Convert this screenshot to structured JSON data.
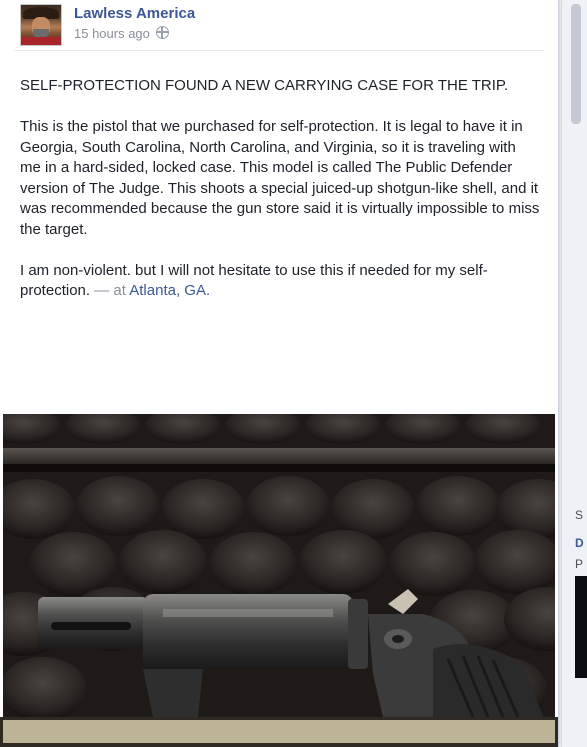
{
  "post": {
    "author": "Lawless America",
    "timestamp": "15 hours ago",
    "paragraphs": [
      "SELF-PROTECTION FOUND A NEW CARRYING CASE FOR THE TRIP.",
      "This is the pistol that we purchased for self-protection. It is legal to have it in Georgia, South Carolina, North Carolina, and Virginia, so it is traveling with me in a hard-sided, locked case. This model is called The Public Defender version of The Judge. This shoots a special juiced-up shotgun-like shell, and it was recommended because the gun store said it is virtually impossible to miss the target."
    ],
    "closing": "I am non-violent. but I will not hesitate to use this if needed for my self-protection.",
    "location_prefix": "— at",
    "location": "Atlanta, GA."
  },
  "side": {
    "frag1": "S",
    "frag2": "D",
    "frag3": "P"
  },
  "icons": {
    "privacy": "globe-icon"
  },
  "colors": {
    "link": "#3b5998",
    "meta": "#898f9c",
    "text": "#1d2129"
  }
}
